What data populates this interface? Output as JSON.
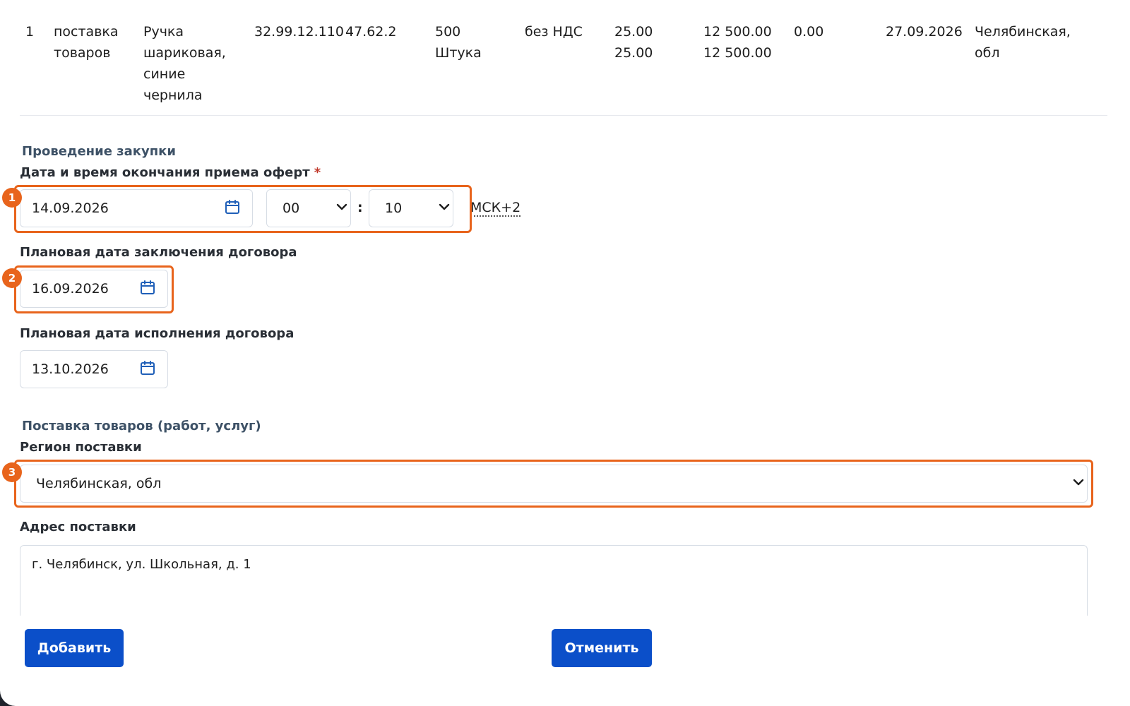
{
  "table_row": {
    "num": "1",
    "type": "поставка\nтоваров",
    "name": "Ручка\nшариковая,\nсиние\nчернила",
    "okpd": "32.99.12.110",
    "okved": "47.62.2",
    "qty": "500\nШтука",
    "vat": "без НДС",
    "price": "25.00\n25.00",
    "sum": "12 500.00\n12 500.00",
    "extra": "0.00",
    "date": "27.09.2026",
    "region": "Челябинская,\nобл"
  },
  "procurement": {
    "section_title": "Проведение закупки",
    "deadline_label": "Дата и время окончания приема оферт",
    "required_mark": "*",
    "deadline_date": "14.09.2026",
    "deadline_hour": "00",
    "time_separator": ":",
    "deadline_minute": "10",
    "timezone": "МСК+2",
    "contract_date_label": "Плановая дата заключения договора",
    "contract_date": "16.09.2026",
    "execution_date_label": "Плановая дата исполнения договора",
    "execution_date": "13.10.2026"
  },
  "delivery": {
    "section_title": "Поставка товаров (работ, услуг)",
    "region_label": "Регион поставки",
    "region_value": "Челябинская, обл",
    "address_label": "Адрес поставки",
    "address_value": "г. Челябинск, ул. Школьная, д. 1"
  },
  "buttons": {
    "add": "Добавить",
    "cancel": "Отменить"
  },
  "annotations": [
    "1",
    "2",
    "3"
  ],
  "colors": {
    "primary_button": "#0b4fc9",
    "highlight": "#e8641c",
    "calendar_icon": "#1f5fb8",
    "section_title": "#3d5166"
  },
  "icons": {
    "calendar": "calendar-icon",
    "chevron": "chevron-down-icon"
  }
}
